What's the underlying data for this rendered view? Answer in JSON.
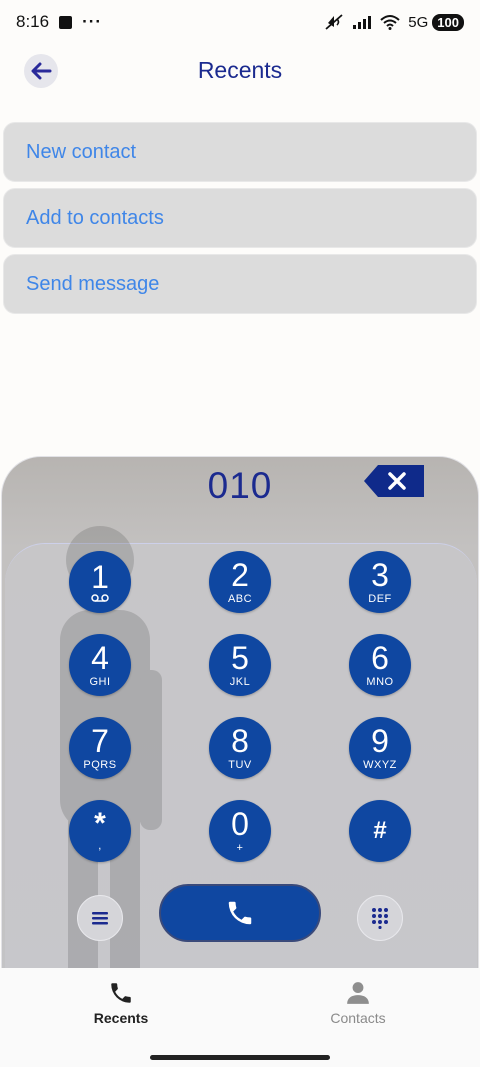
{
  "status_bar": {
    "time": "8:16",
    "more": "···",
    "network": "5G",
    "battery": "100"
  },
  "header": {
    "title": "Recents"
  },
  "actions": [
    {
      "label": "New contact"
    },
    {
      "label": "Add to contacts"
    },
    {
      "label": "Send message"
    }
  ],
  "dialer": {
    "number": "010",
    "keys": [
      {
        "digit": "1",
        "letters": ""
      },
      {
        "digit": "2",
        "letters": "ABC"
      },
      {
        "digit": "3",
        "letters": "DEF"
      },
      {
        "digit": "4",
        "letters": "GHI"
      },
      {
        "digit": "5",
        "letters": "JKL"
      },
      {
        "digit": "6",
        "letters": "MNO"
      },
      {
        "digit": "7",
        "letters": "PQRS"
      },
      {
        "digit": "8",
        "letters": "TUV"
      },
      {
        "digit": "9",
        "letters": "WXYZ"
      },
      {
        "digit": "*",
        "letters": ","
      },
      {
        "digit": "0",
        "letters": "+"
      },
      {
        "digit": "#",
        "letters": ""
      }
    ]
  },
  "bottom_nav": {
    "recents_label": "Recents",
    "contacts_label": "Contacts"
  },
  "colors": {
    "accent": "#0f47a1",
    "title": "#1b2a8f",
    "action_text": "#3f86e8"
  }
}
